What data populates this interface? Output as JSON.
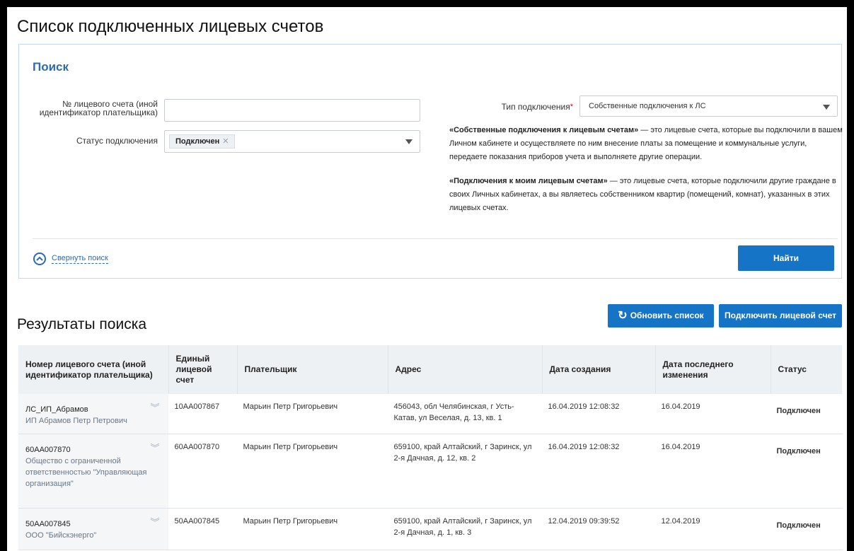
{
  "page": {
    "title": "Список подключенных лицевых счетов"
  },
  "search": {
    "title": "Поиск",
    "account_label": "№ лицевого счета (иной идентификатор плательщика)",
    "account_value": "",
    "status_label": "Статус подключения",
    "status_tag": "Подключен",
    "type_label": "Тип подключения",
    "type_value": "Собственные подключения к ЛС",
    "desc1_bold": "«Собственные подключения к лицевым счетам»",
    "desc1_text": " — это лицевые счета, которые вы подключили в вашем Личном кабинете и осуществляете по ним внесение платы за помещение и коммунальные услуги, передаете показания приборов учета и выполняете другие операции.",
    "desc2_bold": "«Подключения к моим лицевым счетам»",
    "desc2_text": " — это лицевые счета, которые подключили другие граждане в своих Личных кабинетах, а вы являетесь собственником квартир (помещений, комнат), указанных в этих лицевых счетах.",
    "collapse_label": "Свернуть поиск",
    "find_label": "Найти"
  },
  "results": {
    "title": "Результаты поиска",
    "refresh_label": "Обновить список",
    "connect_label": "Подключить лицевой счет",
    "columns": [
      "Номер лицевого счета (иной идентификатор плательщика)",
      "Единый лицевой счет",
      "Плательщик",
      "Адрес",
      "Дата создания",
      "Дата последнего изменения",
      "Статус"
    ],
    "rows": [
      {
        "account": "ЛС_ИП_Абрамов",
        "org": "ИП Абрамов Петр Петрович",
        "unified": "10АА007867",
        "payer": "Марьин Петр Григорьевич",
        "address": "456043, обл Челябинская, г Усть-Катав, ул Веселая, д. 13, кв. 1",
        "created": "16.04.2019 12:08:32",
        "modified": "16.04.2019",
        "status": "Подключен"
      },
      {
        "account": "60АА007870",
        "org": "Общество с ограниченной ответственностью \"Управляющая организация\"",
        "unified": "60АА007870",
        "payer": "Марьин Петр Григорьевич",
        "address": "659100, край Алтайский, г Заринск, ул 2-я Дачная, д. 12, кв. 2",
        "created": "16.04.2019 12:08:32",
        "modified": "16.04.2019",
        "status": "Подключен"
      },
      {
        "account": "50АА007845",
        "org": "ООО \"Бийскэнерго\"",
        "unified": "50АА007845",
        "payer": "Марьин Петр Григорьевич",
        "address": "659100, край Алтайский, г Заринск, ул 2-я Дачная, д. 1, кв. 3",
        "created": "12.04.2019 09:39:52",
        "modified": "12.04.2019",
        "status": "Подключен"
      }
    ]
  },
  "colors": {
    "accent": "#1574c5",
    "status_connected": "#2e8b28",
    "header_bg": "#edf1f4"
  }
}
